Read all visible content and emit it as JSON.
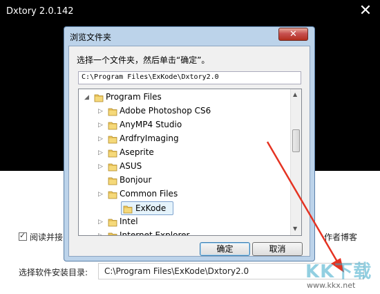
{
  "installer": {
    "title": "Dxtory 2.0.142",
    "close_glyph": "✕",
    "agree_label": "阅读并接",
    "blog_label": "作者博客",
    "dir_label": "选择软件安装目录:",
    "dir_value": "C:\\Program Files\\ExKode\\Dxtory2.0"
  },
  "dialog": {
    "title": "浏览文件夹",
    "close_glyph": "✕",
    "prompt": "选择一个文件夹，然后单击“确定”。",
    "path_value": "C:\\Program Files\\ExKode\\Dxtory2.0",
    "tree": [
      {
        "label": "Program Files",
        "expander": "◢",
        "level": 0
      },
      {
        "label": "Adobe Photoshop CS6",
        "expander": "▷",
        "level": 1
      },
      {
        "label": "AnyMP4 Studio",
        "expander": "▷",
        "level": 1
      },
      {
        "label": "ArdfryImaging",
        "expander": "▷",
        "level": 1
      },
      {
        "label": "Aseprite",
        "expander": "▷",
        "level": 1
      },
      {
        "label": "ASUS",
        "expander": "▷",
        "level": 1
      },
      {
        "label": "Bonjour",
        "expander": "",
        "level": 1
      },
      {
        "label": "Common Files",
        "expander": "▷",
        "level": 1
      },
      {
        "label": "ExKode",
        "expander": "",
        "level": 1,
        "selected": true
      },
      {
        "label": "Intel",
        "expander": "▷",
        "level": 1
      },
      {
        "label": "Internet Explorer",
        "expander": "▷",
        "level": 1
      }
    ],
    "ok_label": "确定",
    "cancel_label": "取消"
  },
  "watermark": {
    "brand": "KK下载",
    "url": "www.kkx.net"
  },
  "colors": {
    "arrow": "#e53322",
    "dialog_frame": "#bcd3ea",
    "selection": "#e5f3fb",
    "folder": "#e8c25a"
  }
}
